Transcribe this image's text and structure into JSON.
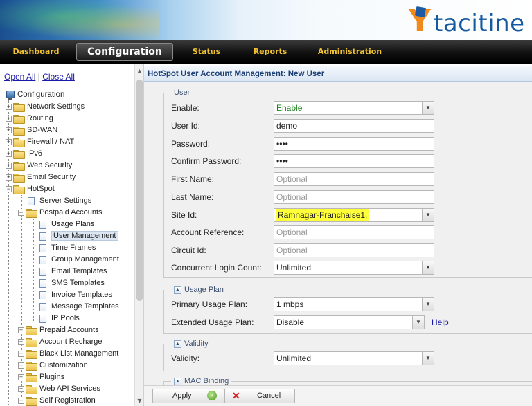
{
  "header": {
    "brand": "tacitine",
    "brand_mark": "Y"
  },
  "nav": {
    "items": [
      "Dashboard",
      "Configuration",
      "Status",
      "Reports",
      "Administration"
    ],
    "active": "Configuration",
    "colors": {
      "item": "#f1c232",
      "active": "#ffffff"
    }
  },
  "sidebar": {
    "open_all": "Open All",
    "separator": "|",
    "close_all": "Close All",
    "root": "Configuration",
    "tree": [
      "Network Settings",
      "Routing",
      "SD-WAN",
      "Firewall / NAT",
      "IPv6",
      "Web Security",
      "Email Security",
      "HotSpot",
      "Server Settings",
      "Postpaid Accounts",
      "Usage Plans",
      "User Management",
      "Time Frames",
      "Group Management",
      "Email Templates",
      "SMS Templates",
      "Invoice Templates",
      "Message Templates",
      "IP Pools",
      "Prepaid Accounts",
      "Account Recharge",
      "Black List Management",
      "Customization",
      "Plugins",
      "Web API Services",
      "Self Registration"
    ],
    "selected": "User Management"
  },
  "main": {
    "title": "HotSpot User Account Management: New User",
    "user_section": {
      "legend": "User",
      "enable": {
        "label": "Enable:",
        "value": "Enable"
      },
      "user_id": {
        "label": "User Id:",
        "value": "demo"
      },
      "password": {
        "label": "Password:",
        "value": "demo"
      },
      "confirm_password": {
        "label": "Confirm Password:",
        "value": "demo"
      },
      "first_name": {
        "label": "First Name:",
        "placeholder": "Optional"
      },
      "last_name": {
        "label": "Last Name:",
        "placeholder": "Optional"
      },
      "site_id": {
        "label": "Site Id:",
        "value": "Ramnagar-Franchaise1."
      },
      "account_reference": {
        "label": "Account Reference:",
        "placeholder": "Optional"
      },
      "circuit_id": {
        "label": "Circuit Id:",
        "placeholder": "Optional"
      },
      "concurrent_login": {
        "label": "Concurrent Login Count:",
        "value": "Unlimited"
      }
    },
    "usage_plan_section": {
      "legend": "Usage Plan",
      "primary": {
        "label": "Primary Usage Plan:",
        "value": "1 mbps"
      },
      "extended": {
        "label": "Extended Usage Plan:",
        "value": "Disable"
      },
      "help": "Help"
    },
    "validity_section": {
      "legend": "Validity",
      "validity": {
        "label": "Validity:",
        "value": "Unlimited"
      }
    },
    "mac_binding_section": {
      "legend": "MAC Binding"
    }
  },
  "footer": {
    "apply": "Apply",
    "cancel": "Cancel"
  },
  "colors": {
    "title_text": "#1c3f73",
    "highlight": "#ffff3a",
    "enable_text": "#1a7d1a",
    "link": "#1a1aa8"
  }
}
